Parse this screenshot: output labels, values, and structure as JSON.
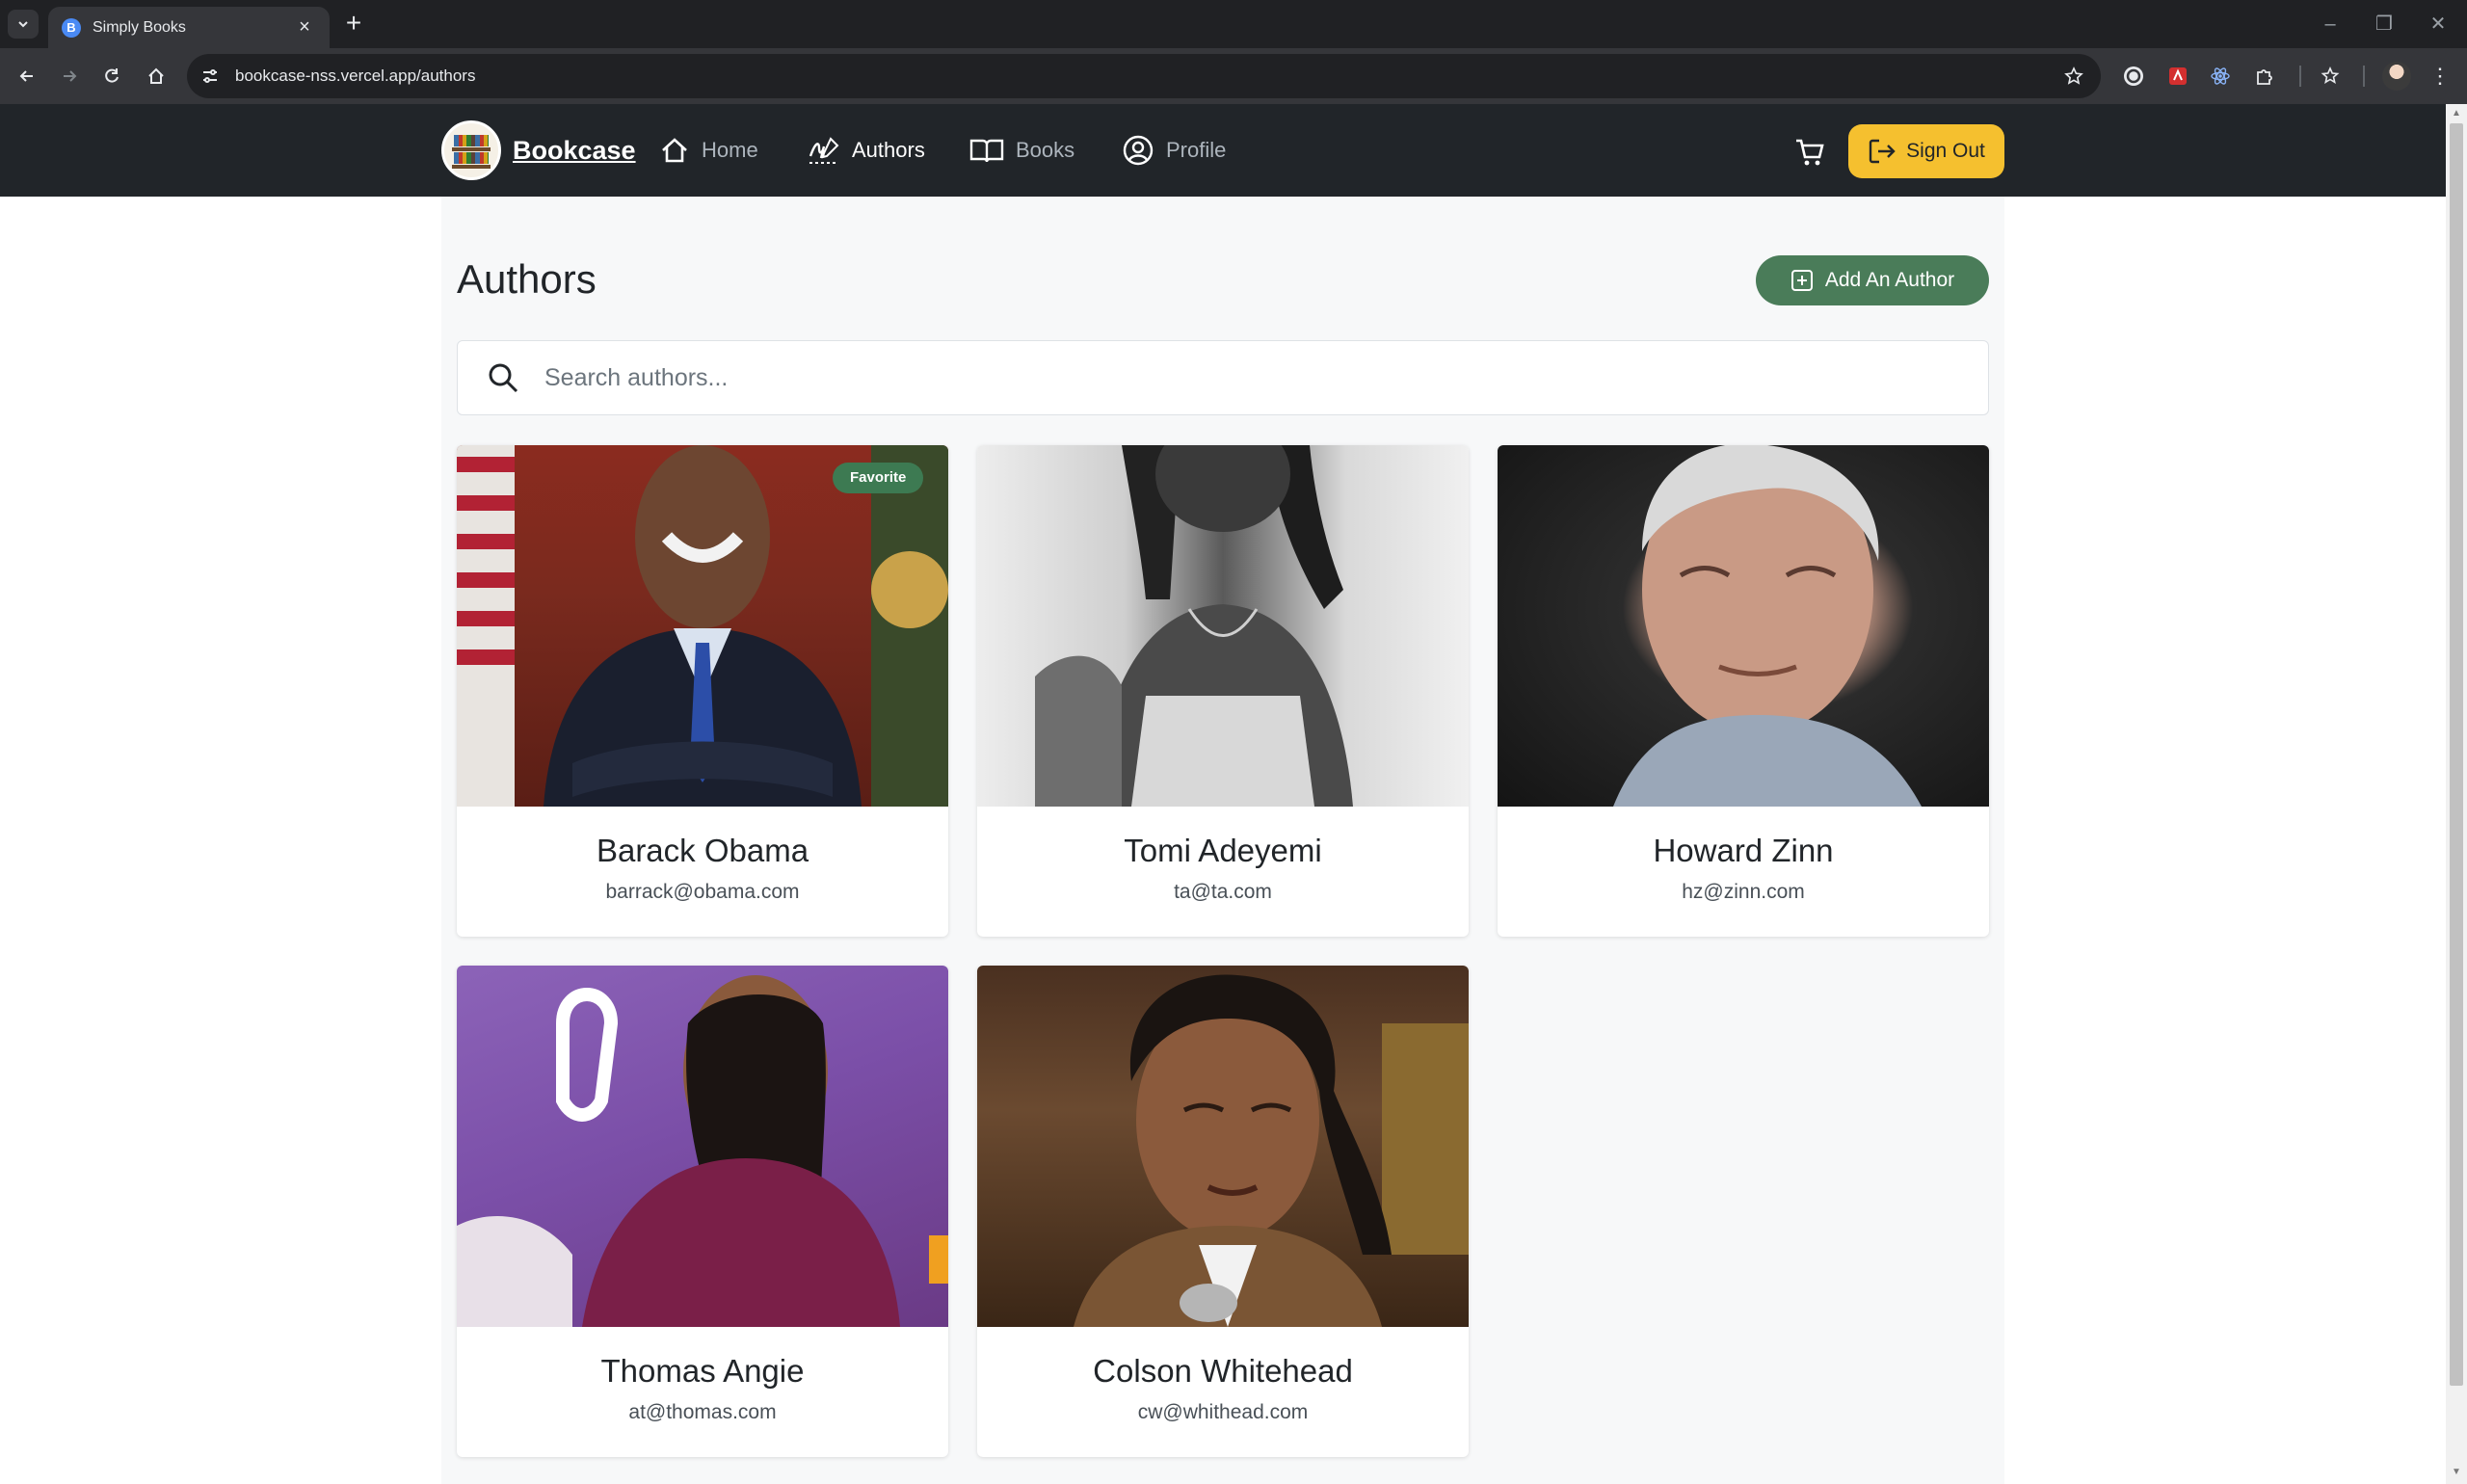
{
  "browser": {
    "tab_title": "Simply Books",
    "url": "bookcase-nss.vercel.app/authors"
  },
  "nav": {
    "brand": "Bookcase",
    "links": [
      {
        "label": "Home",
        "icon": "home-icon"
      },
      {
        "label": "Authors",
        "icon": "signature-icon"
      },
      {
        "label": "Books",
        "icon": "open-book-icon"
      },
      {
        "label": "Profile",
        "icon": "user-circle-icon"
      }
    ],
    "signout_label": "Sign Out"
  },
  "page": {
    "title": "Authors",
    "add_button": "Add An Author",
    "search_placeholder": "Search authors..."
  },
  "authors": [
    {
      "name": "Barack Obama",
      "email": "barrack@obama.com",
      "favorite": true,
      "badge": "Favorite"
    },
    {
      "name": "Tomi Adeyemi",
      "email": "ta@ta.com",
      "favorite": false
    },
    {
      "name": "Howard Zinn",
      "email": "hz@zinn.com",
      "favorite": false
    },
    {
      "name": "Thomas Angie",
      "email": "at@thomas.com",
      "favorite": false
    },
    {
      "name": "Colson Whitehead",
      "email": "cw@whithead.com",
      "favorite": false
    }
  ],
  "colors": {
    "navbar": "#212529",
    "signout": "#f5c02f",
    "add_button": "#4a7c59",
    "favorite_badge": "#3d7a52"
  }
}
